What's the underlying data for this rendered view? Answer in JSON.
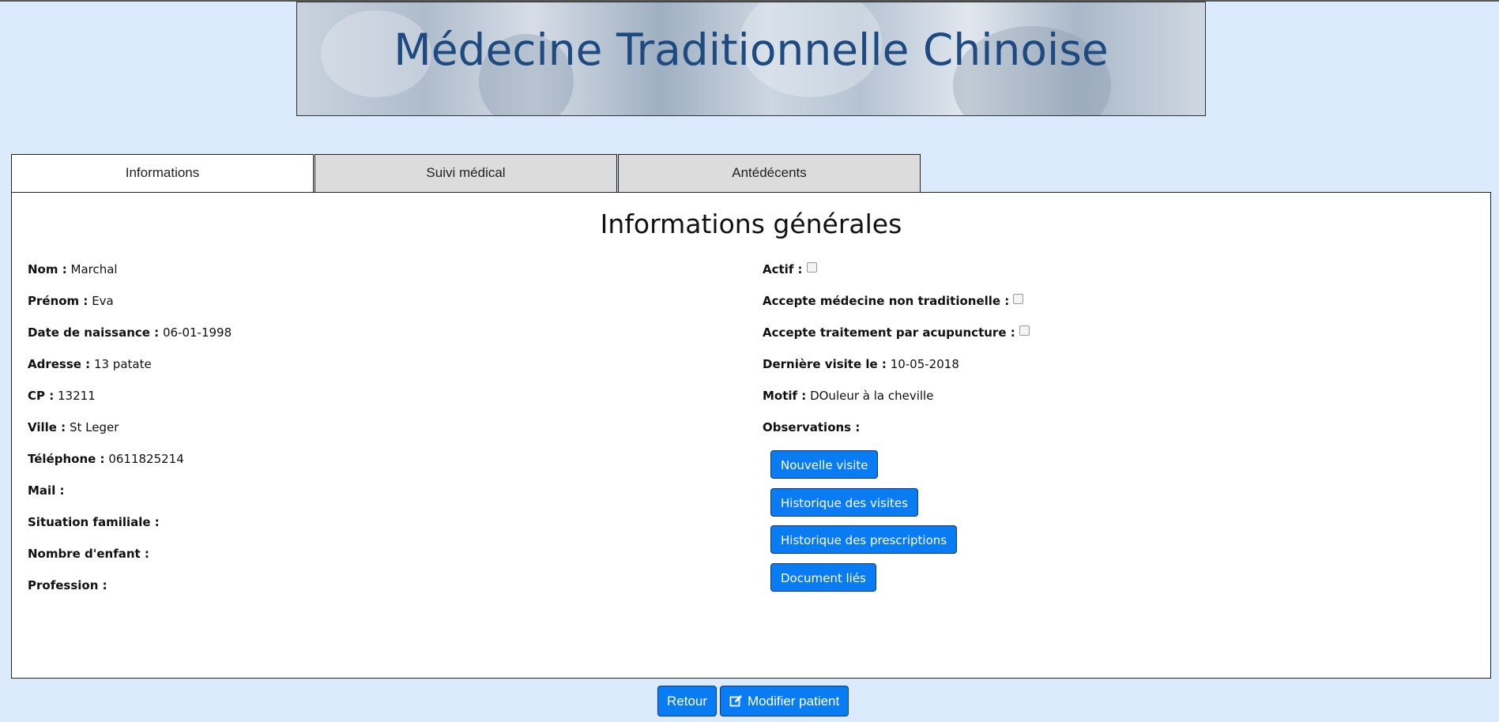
{
  "header": {
    "title": "Médecine Traditionnelle Chinoise"
  },
  "tabs": [
    {
      "label": "Informations",
      "active": true
    },
    {
      "label": "Suivi médical",
      "active": false
    },
    {
      "label": "Antédécents",
      "active": false
    }
  ],
  "section_title": "Informations générales",
  "left_fields": [
    {
      "label": "Nom :",
      "value": "Marchal"
    },
    {
      "label": "Prénom :",
      "value": "Eva"
    },
    {
      "label": "Date de naissance :",
      "value": "06-01-1998"
    },
    {
      "label": "Adresse :",
      "value": "13 patate"
    },
    {
      "label": "CP :",
      "value": "13211"
    },
    {
      "label": "Ville :",
      "value": "St Leger"
    },
    {
      "label": "Téléphone :",
      "value": "0611825214"
    },
    {
      "label": "Mail :",
      "value": ""
    },
    {
      "label": "Situation familiale :",
      "value": ""
    },
    {
      "label": "Nombre d'enfant :",
      "value": ""
    },
    {
      "label": "Profession :",
      "value": ""
    }
  ],
  "right_fields": {
    "actif": {
      "label": "Actif :",
      "checked": false
    },
    "medecine": {
      "label": "Accepte médecine non traditionelle :",
      "checked": false
    },
    "acupuncture": {
      "label": "Accepte traitement par acupuncture :",
      "checked": false
    },
    "derniere_visite": {
      "label": "Dernière visite le :",
      "value": "10-05-2018"
    },
    "motif": {
      "label": "Motif :",
      "value": "DOuleur à la cheville"
    },
    "observations": {
      "label": "Observations :",
      "value": ""
    }
  },
  "actions": {
    "nouvelle_visite": "Nouvelle visite",
    "historique_visites": "Historique des visites",
    "historique_prescriptions": "Historique des prescriptions",
    "documents": "Document liés"
  },
  "footer": {
    "retour": "Retour",
    "modifier": "Modifier patient",
    "modifier_icon": "edit-icon"
  },
  "colors": {
    "background": "#dbeafd",
    "button": "#0a7cf3",
    "title": "#1e4a80"
  }
}
